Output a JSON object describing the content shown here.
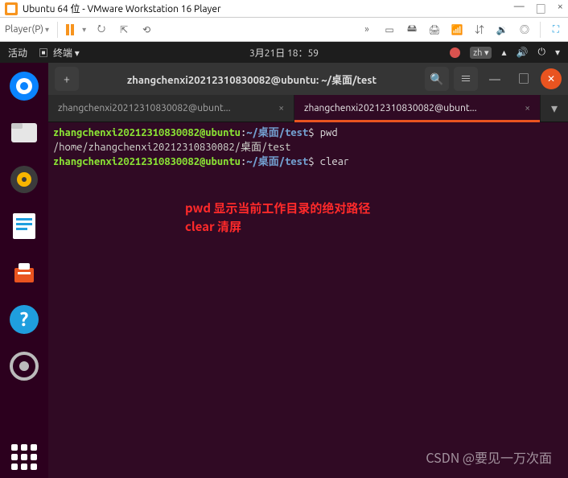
{
  "host": {
    "title": "Ubuntu 64 位 - VMware Workstation 16 Player",
    "min": "—",
    "max": "□",
    "close": "×",
    "player_menu": "Player(P)",
    "icons": {
      "send": "⭮",
      "popout": "⇱",
      "cycle": "⟲",
      "arrows": "»",
      "screen": "▭",
      "disk": "🖴",
      "print": "🖨",
      "net": "📶",
      "usb": "⇵",
      "sound": "🔉",
      "cd": "◎",
      "expand": "⛶"
    }
  },
  "gnome": {
    "activities": "活动",
    "term_label": "终端 ▾",
    "datetime": "3月21日  18：59",
    "lang": "zh ▾",
    "icons": {
      "term": "▣",
      "net": "▴",
      "vol": "🔊",
      "power": "⏻",
      "caret": "▾"
    }
  },
  "dock": {
    "thunderbird": "#0a84ff",
    "files": "#e6e6e6",
    "rhythmbox": "#3b3b3b",
    "writer": "#1f9ede",
    "software": "#ffffff",
    "help": "#1f9ede",
    "settings": "#9e9e9e"
  },
  "termwin": {
    "newtab": "+",
    "title": "zhangchenxi20212310830082@ubuntu: ~/桌面/test",
    "search": "🔍",
    "menu": "≡",
    "min": "—",
    "max": "□",
    "close": "✕",
    "tabs": [
      {
        "label": "zhangchenxi20212310830082@ubunt...",
        "close": "×"
      },
      {
        "label": "zhangchenxi20212310830082@ubunt...",
        "close": "×"
      }
    ]
  },
  "terminal": {
    "l1": {
      "user": "zhangchenxi20212310830082@ubuntu",
      "colon": ":",
      "path": "~/桌面/test",
      "dollar": "$ ",
      "cmd": "pwd"
    },
    "l2": "/home/zhangchenxi20212310830082/桌面/test",
    "l3": {
      "user": "zhangchenxi20212310830082@ubuntu",
      "colon": ":",
      "path": "~/桌面/test",
      "dollar": "$ ",
      "cmd": "clear"
    }
  },
  "annotation": {
    "line1": "pwd 显示当前工作目录的绝对路径",
    "line2": "clear 清屏"
  },
  "watermark": "CSDN @要见一万次面"
}
